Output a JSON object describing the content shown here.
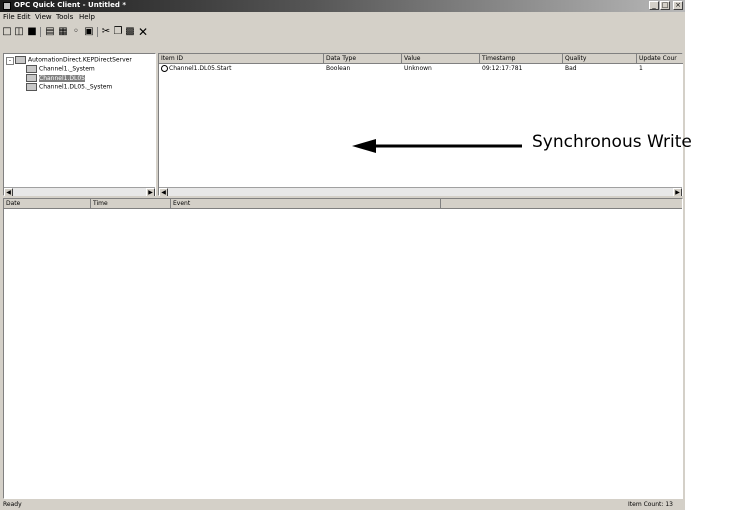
{
  "window": {
    "title": "OPC Quick Client - Untitled *",
    "controls": [
      "_",
      "□",
      "×"
    ]
  },
  "menu": [
    "File",
    "Edit",
    "View",
    "Tools",
    "Help"
  ],
  "toolbar_icons": [
    "new-icon",
    "open-icon",
    "save-icon",
    "new-server-icon",
    "new-group-icon",
    "new-item-icon",
    "properties-icon",
    "cut-icon",
    "copy-icon",
    "paste-icon",
    "delete-icon"
  ],
  "tree": {
    "root": "AutomationDirect.KEPDirectServer",
    "items": [
      "Channel1._System",
      "Channel1.DL05",
      "Channel1.DL05._System"
    ],
    "selected_index": 1
  },
  "items_table": {
    "columns": [
      "Item ID",
      "Data Type",
      "Value",
      "Timestamp",
      "Quality",
      "Update Cour"
    ],
    "rows": [
      [
        "Channel1.DL05.Start",
        "Boolean",
        "Unknown",
        "09:12:17:781",
        "Bad",
        "1"
      ]
    ]
  },
  "event_log": {
    "columns": [
      "Date",
      "Time",
      "Event"
    ]
  },
  "status": {
    "left": "Ready",
    "right": "Item Count: 13"
  },
  "annotation": {
    "label": "Synchronous Write"
  }
}
